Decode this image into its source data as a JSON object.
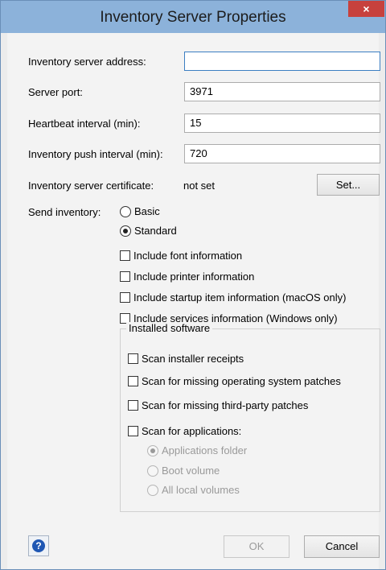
{
  "window": {
    "title": "Inventory Server Properties",
    "close_glyph": "×"
  },
  "fields": {
    "server_address_label": "Inventory server address:",
    "server_address_value": "",
    "server_port_label": "Server port:",
    "server_port_value": "3971",
    "heartbeat_label": "Heartbeat interval (min):",
    "heartbeat_value": "15",
    "push_interval_label": "Inventory push interval (min):",
    "push_interval_value": "720"
  },
  "certificate": {
    "label": "Inventory server certificate:",
    "status": "not set",
    "set_button": "Set..."
  },
  "send_inventory": {
    "label": "Send inventory:",
    "options": [
      {
        "label": "Basic",
        "checked": false
      },
      {
        "label": "Standard",
        "checked": true
      }
    ]
  },
  "include_options": [
    {
      "label": "Include font information",
      "checked": false
    },
    {
      "label": "Include printer information",
      "checked": false
    },
    {
      "label": "Include startup item information (macOS only)",
      "checked": false
    },
    {
      "label": "Include services information (Windows only)",
      "checked": false
    }
  ],
  "installed_software": {
    "title": "Installed software",
    "options": [
      {
        "label": "Scan installer receipts",
        "checked": false
      },
      {
        "label": "Scan for missing operating system patches",
        "checked": false
      },
      {
        "label": "Scan for missing third-party patches",
        "checked": false
      },
      {
        "label": "Scan for applications:",
        "checked": false
      }
    ],
    "app_scope": [
      {
        "label": "Applications folder",
        "checked": true,
        "enabled": false
      },
      {
        "label": "Boot volume",
        "checked": false,
        "enabled": false
      },
      {
        "label": "All local volumes",
        "checked": false,
        "enabled": false
      }
    ]
  },
  "footer": {
    "help_glyph": "?",
    "ok_button": "OK",
    "cancel_button": "Cancel"
  },
  "colors": {
    "titlebar": "#8cb2da",
    "close_button": "#c7413d",
    "client_background": "#f3f3f3",
    "focus_border": "#3c7fc2"
  }
}
